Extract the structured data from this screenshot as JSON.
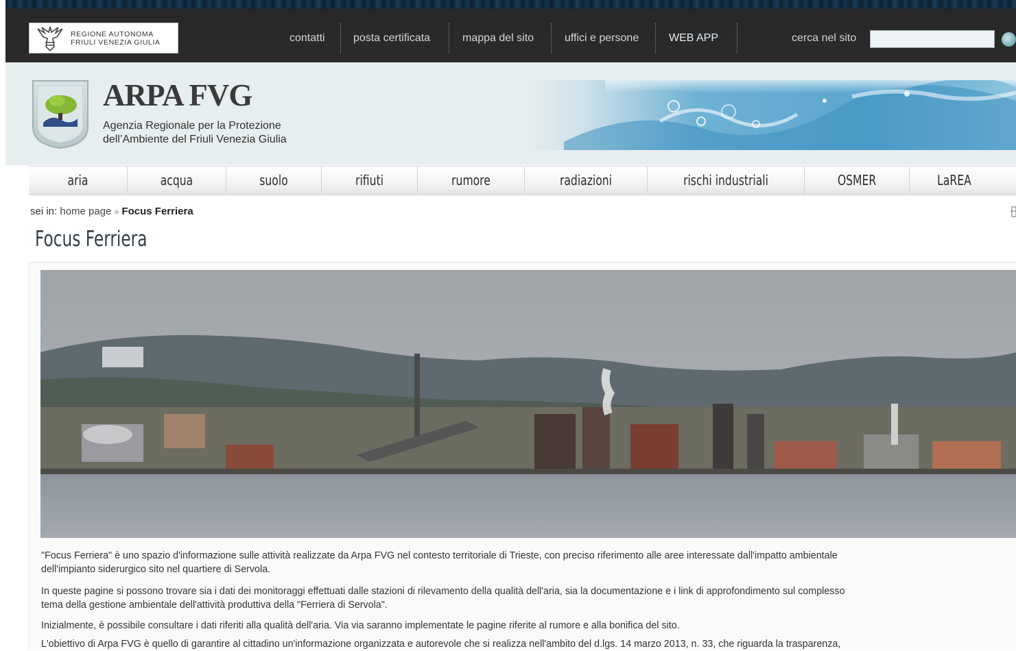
{
  "topbar": {
    "region_logo_text": [
      "REGIONE AUTONOMA",
      "FRIULI VENEZIA GIULIA"
    ],
    "links": [
      "contatti",
      "posta certificata",
      "mappa del sito",
      "uffici e persone",
      "WEB APP"
    ],
    "search_label": "cerca nel sito",
    "search_value": ""
  },
  "header": {
    "brand_title": "ARPA FVG",
    "brand_subtitle_line1": "Agenzia Regionale per la Protezione",
    "brand_subtitle_line2": "dell’Ambiente del Friuli Venezia Giulia",
    "emblem_text": "ARPA FVG"
  },
  "mainnav": {
    "items": [
      "aria",
      "acqua",
      "suolo",
      "rifiuti",
      "rumore",
      "radiazioni",
      "rischi industriali",
      "OSMER",
      "LaREA"
    ]
  },
  "breadcrumb": {
    "prefix": "sei in:",
    "home": "home page",
    "separator": "»",
    "current": "Focus Ferriera"
  },
  "page": {
    "title": "Focus Ferriera",
    "paragraphs": [
      "\"Focus Ferriera\" è uno spazio d'informazione sulle attività realizzate da Arpa FVG nel contesto territoriale di Trieste, con preciso riferimento alle aree interessate dall'impatto ambientale",
      "dell'impianto siderurgico sito nel quartiere di Servola.",
      "In queste pagine si possono trovare sia i dati dei monitoraggi effettuati dalle stazioni di rilevamento della qualità dell'aria, sia la documentazione e i link di approfondimento sul complesso",
      "tema della gestione ambientale dell'attività produttiva della \"Ferriera di Servola\".",
      "Inizialmente, è possibile consultare i dati riferiti alla qualità dell'aria. Via via saranno implementate le pagine riferite al rumore e alla bonifica del sito.",
      "L'obiettivo di Arpa FVG è quello di garantire al cittadino un'informazione organizzata e autorevole che si realizza nell'ambito del d.lgs. 14 marzo 2013, n. 33, che riguarda la trasparenza,"
    ]
  },
  "colors": {
    "topbar": "#2b2b2b",
    "header_bg": "#e7eef0",
    "link_text": "#d6d6d6",
    "title_text": "#2f3f4a"
  }
}
